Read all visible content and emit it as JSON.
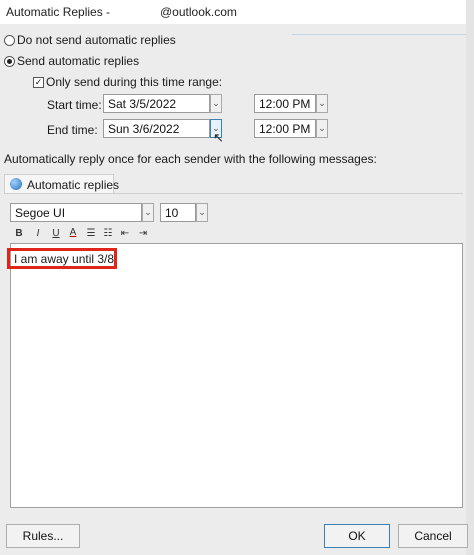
{
  "window": {
    "title_left": "Automatic Replies -",
    "title_right": "@outlook.com"
  },
  "options": {
    "no_auto": "Do not send automatic replies",
    "send_auto": "Send automatic replies",
    "time_range": "Only send during this time range:"
  },
  "range": {
    "start_label": "Start time:",
    "start_date": "Sat 3/5/2022",
    "start_time": "12:00 PM",
    "end_label": "End time:",
    "end_date": "Sun 3/6/2022",
    "end_time": "12:00 PM"
  },
  "instructions": "Automatically reply once for each sender with the following messages:",
  "tab": {
    "label": "Automatic replies"
  },
  "format": {
    "font": "Segoe UI",
    "size": "10",
    "bold": "B",
    "italic": "I",
    "underline": "U",
    "color": "A"
  },
  "message": "I am away until 3/8",
  "buttons": {
    "rules": "Rules...",
    "ok": "OK",
    "cancel": "Cancel"
  },
  "colors": {
    "highlight": "#e0261b",
    "accent": "#3c7fb1"
  }
}
